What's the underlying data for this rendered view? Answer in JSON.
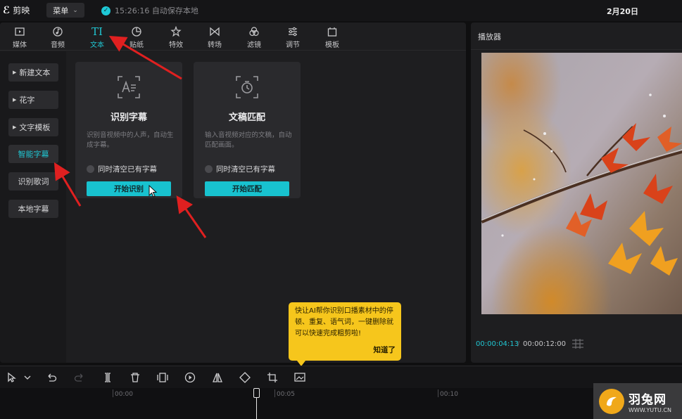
{
  "topbar": {
    "app_name": "剪映",
    "menu_label": "菜单",
    "save_status": "15:26:16 自动保存本地",
    "date": "2月20日"
  },
  "toolbar": {
    "tabs": [
      {
        "label": "媒体",
        "icon": "media-icon"
      },
      {
        "label": "音频",
        "icon": "audio-icon"
      },
      {
        "label": "文本",
        "icon": "text-icon",
        "active": true
      },
      {
        "label": "贴纸",
        "icon": "sticker-icon"
      },
      {
        "label": "特效",
        "icon": "effects-icon"
      },
      {
        "label": "转场",
        "icon": "transition-icon"
      },
      {
        "label": "滤镜",
        "icon": "filter-icon"
      },
      {
        "label": "调节",
        "icon": "adjust-icon"
      },
      {
        "label": "模板",
        "icon": "template-icon"
      }
    ]
  },
  "sidebar": {
    "items": [
      {
        "label": "新建文本"
      },
      {
        "label": "花字"
      },
      {
        "label": "文字模板"
      },
      {
        "label": "智能字幕",
        "active": true
      },
      {
        "label": "识别歌词"
      },
      {
        "label": "本地字幕"
      }
    ]
  },
  "cards": [
    {
      "title": "识别字幕",
      "desc": "识别音视频中的人声，自动生成字幕。",
      "check_label": "同时清空已有字幕",
      "button": "开始识别"
    },
    {
      "title": "文稿匹配",
      "desc": "输入音视频对应的文稿，自动匹配画面。",
      "check_label": "同时清空已有字幕",
      "button": "开始匹配"
    }
  ],
  "player": {
    "title": "播放器",
    "current_time": "00:00:04:13",
    "separator": "/",
    "total_time": "00:00:12:00"
  },
  "tooltip": {
    "text": "快让AI帮你识别口播素材中的停顿、重复、语气词，一键删除就可以快速完成粗剪啦!",
    "button": "知道了"
  },
  "timeline": {
    "ruler": [
      "00:00",
      "00:05",
      "00:10"
    ]
  },
  "watermark": {
    "name": "羽兔网",
    "url": "WWW.YUTU.CN"
  },
  "colors": {
    "accent": "#18c2cf",
    "tooltip": "#f6c61c",
    "annotation": "#e02020"
  }
}
